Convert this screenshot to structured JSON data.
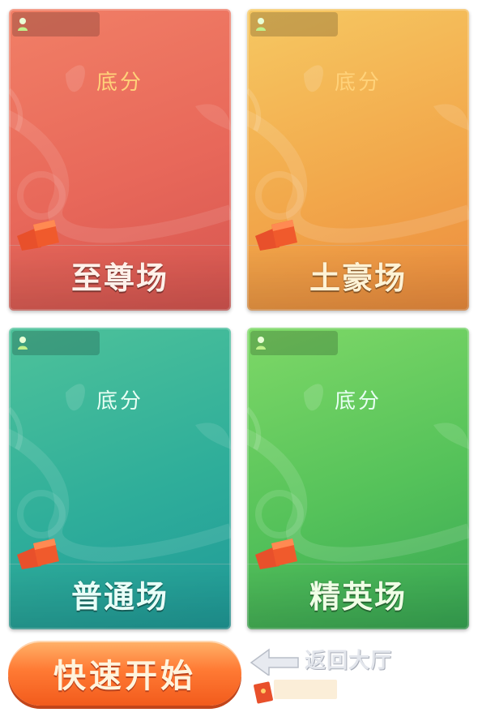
{
  "rooms": [
    {
      "id": "red",
      "score_label": "底分",
      "name": "至尊场"
    },
    {
      "id": "yellow",
      "score_label": "底分",
      "name": "土豪场"
    },
    {
      "id": "teal",
      "score_label": "底分",
      "name": "普通场"
    },
    {
      "id": "green",
      "score_label": "底分",
      "name": "精英场"
    }
  ],
  "actions": {
    "quick_start_label": "快速开始",
    "back_label": "返回大厅"
  },
  "colors": {
    "red_card": "#e8685a",
    "yellow_card": "#f2a84b",
    "teal_card": "#2fae9a",
    "green_card": "#55c25a",
    "quick_start": "#ff7a34"
  },
  "icons": {
    "player": "player-count-icon",
    "hongbao": "red-envelope-icon",
    "back": "back-arrow-icon"
  }
}
